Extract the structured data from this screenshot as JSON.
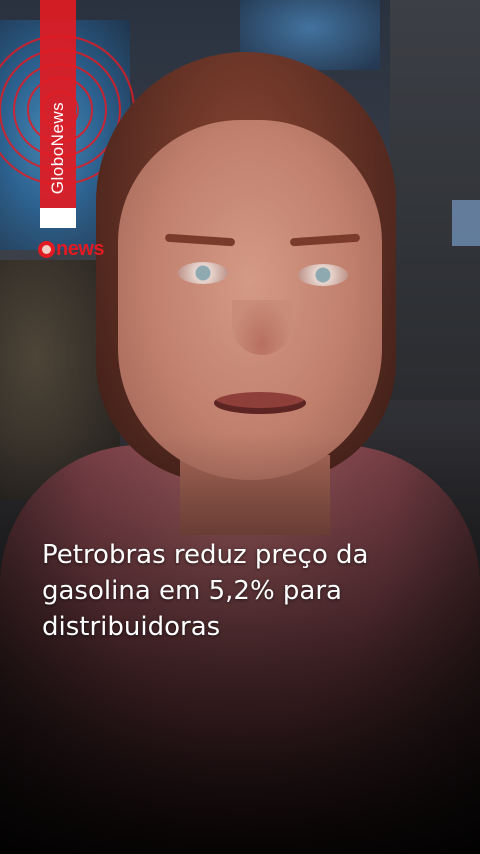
{
  "channel": {
    "tag_label": "GloboNews",
    "logo_text": "news",
    "brand_color": "#e21b23"
  },
  "headline": {
    "lines": [
      "Petrobras reduz preço da",
      "gasolina em 5,2% para",
      "distribuidoras"
    ]
  }
}
